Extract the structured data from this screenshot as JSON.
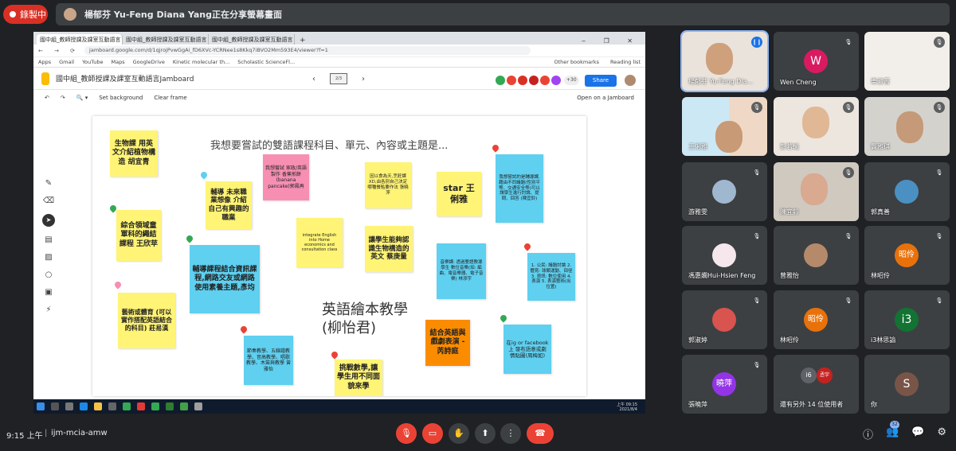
{
  "top": {
    "recording_label": "錄製中",
    "presenter_banner": "楊郁芬 Yu-Feng Diana Yang正在分享螢幕畫面"
  },
  "browser": {
    "tabs": [
      "國中組_教師授課及課室互動語言 Jamboard",
      "國中組_教師授課及課室互動語言",
      "國中組_教師授課及課室互動語言"
    ],
    "url": "jamboard.google.com/d/1qjrojPvwGgAi_fD6XVc-YCRNee1s8Kkq7iBVO2Mm593E4/viewer?f=1",
    "bookmarks": [
      "Apps",
      "Gmail",
      "YouTube",
      "Maps",
      "GoogleDrive",
      "Kinetic molecular th...",
      "Scholastic ScienceFl..."
    ],
    "bookmarks_right": [
      "Other bookmarks",
      "Reading list"
    ]
  },
  "jamboard": {
    "title": "國中組_教師授課及課室互動語言Jamboard",
    "frame_indicator": "2/3",
    "collab_count": "+30",
    "share_label": "Share",
    "toolbar": {
      "set_background": "Set background",
      "clear_frame": "Clear frame",
      "open_on_jamboard": "Open on a Jamboard"
    },
    "canvas_title": "我想要嘗試的雙語課程科目、單元、內容或主題是...",
    "big_text": "英語繪本教學(柳怡君)",
    "notes": [
      "生物課 用英文介紹植物構造 胡宜青",
      "綜合領域童軍科的繩結課程 王欣苹",
      "輔導 未來職業想像 介紹自己有興趣的職業",
      "我想嘗試 家政/英語 製作 香蕉煎餅(banana pancake)郭鳳再",
      "因以食為天,烹飪課 XD,由各別自己決定哪種餐點要作法 張曉萍",
      "star 王俐雅",
      "我想嘗試的是輔導課,藉由不同議題(性別平等、交通安全等)可以讓學生進行討論、提問、回答 (陳宜鈴)",
      "integrate English into Home economics and consultation class",
      "讓學生能夠認識生物構造的英文 蔡庚量",
      "輔導課程結合資訊課程,網路交友或網路使用素養主題,彥均",
      "音樂課: 透過雙語教導學生 數位音樂(如: 編曲、電音樂器、電子音樂) 林添宇",
      "1. 公民: 議題討論 2. 體育: 球類運動、田徑 3. 資訊: 數位使用 4. 表演 5. 表演藝術(出位置)",
      "藝術或體育 (可以實作搭配英語結合的科目) 莊易漢",
      "節奏教學、五線譜教學、音高教學、唱歌教學、木笛與教學 曾雅怡",
      "挑戰數學,讓學生用不同面貌來學",
      "結合英語與戲劇表演 - 芮詩庭",
      "在ig or facebook上 發布語意或劇情貼圖(周梅如)"
    ]
  },
  "taskbar": {
    "time": "上午 09:15",
    "date": "2021/8/4"
  },
  "participants": [
    {
      "name": "楊郁芬 Yu-Feng Dia...",
      "type": "video"
    },
    {
      "name": "Wen Cheng",
      "type": "letter",
      "letter": "W",
      "color": "#d81b60"
    },
    {
      "name": "樂淑菁",
      "type": "video"
    },
    {
      "name": "王俐雅",
      "type": "video"
    },
    {
      "name": "彭若瑜",
      "type": "video"
    },
    {
      "name": "龔雅琪",
      "type": "video"
    },
    {
      "name": "游雅雯",
      "type": "photo"
    },
    {
      "name": "陳宜鈴",
      "type": "video"
    },
    {
      "name": "郭真善",
      "type": "photo"
    },
    {
      "name": "馮惠嫻Hui-Hsien Feng",
      "type": "photo"
    },
    {
      "name": "曾雅怡",
      "type": "photo"
    },
    {
      "name": "林昭伶",
      "type": "letter",
      "letter": "昭伶",
      "color": "#e8710a"
    },
    {
      "name": "郭淑婷",
      "type": "photo"
    },
    {
      "name": "林昭伶",
      "type": "letter",
      "letter": "昭伶",
      "color": "#e8710a"
    },
    {
      "name": "i3林思諭",
      "type": "letter",
      "letter": "i3",
      "color": "#137333"
    },
    {
      "name": "張曉萍",
      "type": "letter",
      "letter": "曉萍",
      "color": "#9334e6"
    },
    {
      "name": "還有另外 14 位使用者",
      "type": "more",
      "letters": [
        "i6",
        "丞宇"
      ]
    },
    {
      "name": "你",
      "type": "letter",
      "letter": "S",
      "color": "#795548"
    }
  ],
  "bottom": {
    "time": "9:15 上午",
    "separator": "|",
    "meeting_code": "ijm-mcia-amw",
    "participant_count": "32"
  },
  "colors": {
    "background": "#202124",
    "tile": "#3c4043",
    "danger": "#ea4335",
    "accent": "#8ab4f8"
  }
}
